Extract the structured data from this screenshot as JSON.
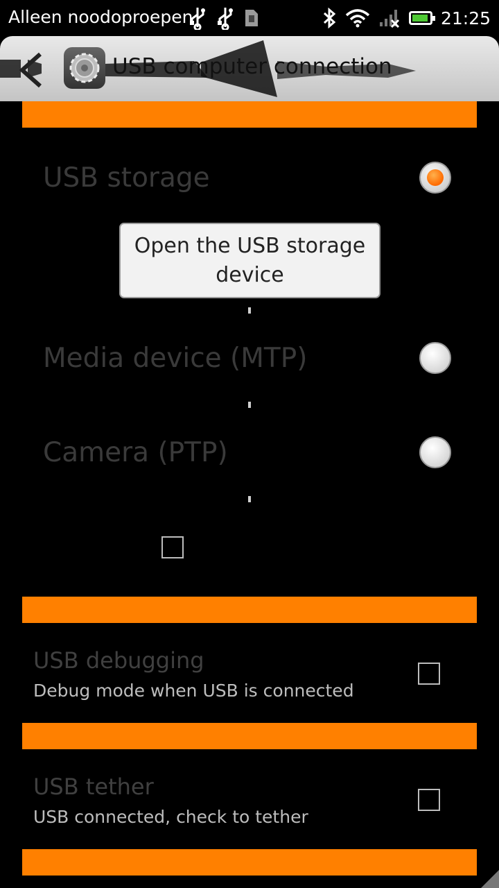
{
  "status_bar": {
    "carrier": "Alleen noodoproepen",
    "time": "21:25",
    "battery_level": 0.9,
    "icons": [
      "usb-icon",
      "usb-icon",
      "sim-icon",
      "bluetooth-icon",
      "wifi-icon",
      "signal-icon",
      "battery-icon"
    ]
  },
  "header": {
    "title": "USB computer connection"
  },
  "connection": {
    "options": [
      {
        "label": "USB storage",
        "selected": true
      },
      {
        "label": "Media device (MTP)",
        "selected": false
      },
      {
        "label": "Camera (PTP)",
        "selected": false
      }
    ],
    "tooltip": "Open the USB storage device"
  },
  "preferences": [
    {
      "title": "USB debugging",
      "summary": "Debug mode when USB is connected",
      "checked": false
    },
    {
      "title": "USB tether",
      "summary": "USB connected, check to tether",
      "checked": false
    }
  ],
  "colors": {
    "accent": "#ff8000",
    "background": "#000000"
  }
}
